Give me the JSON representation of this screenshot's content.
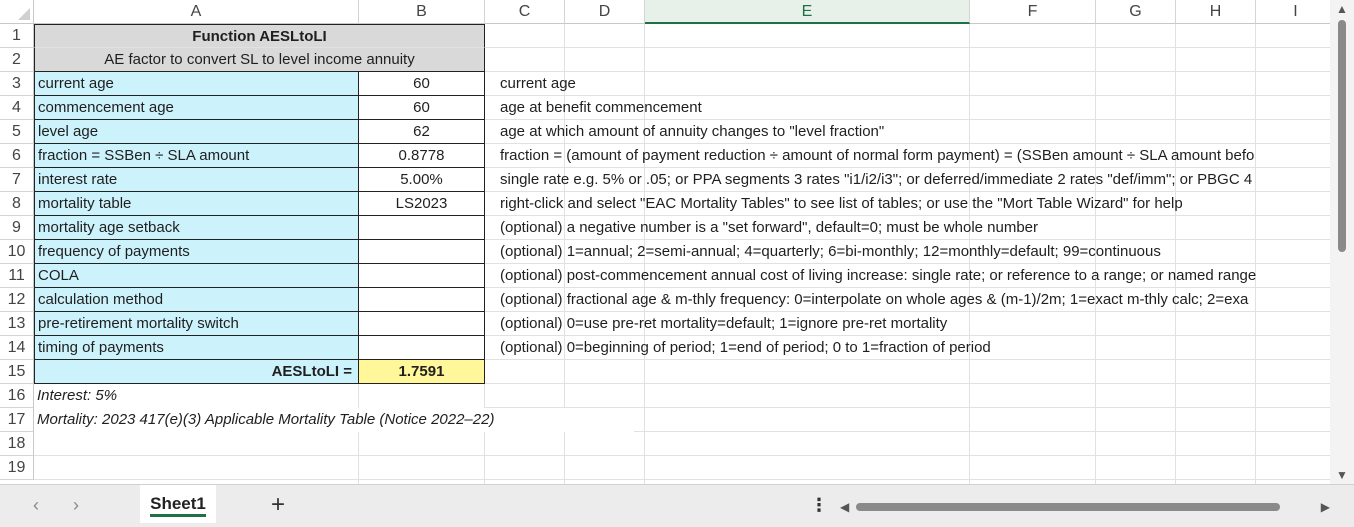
{
  "columns": [
    "A",
    "B",
    "C",
    "D",
    "E",
    "F",
    "G",
    "H",
    "I"
  ],
  "selected_column": "E",
  "rows": [
    "1",
    "2",
    "3",
    "4",
    "5",
    "6",
    "7",
    "8",
    "9",
    "10",
    "11",
    "12",
    "13",
    "14",
    "15",
    "16",
    "17",
    "18",
    "19"
  ],
  "header": {
    "title": "Function AESLtoLI",
    "subtitle": "AE factor to convert SL to level income annuity"
  },
  "params": [
    {
      "label": "current age",
      "value": "60",
      "desc": "current age"
    },
    {
      "label": "commencement age",
      "value": "60",
      "desc": "age at benefit commencement"
    },
    {
      "label": "level age",
      "value": "62",
      "desc": "age at which amount of annuity changes to \"level fraction\""
    },
    {
      "label": "fraction = SSBen ÷ SLA amount",
      "value": "0.8778",
      "desc": "fraction = (amount of payment reduction ÷ amount of normal form payment) = (SSBen amount ÷ SLA amount befo"
    },
    {
      "label": "interest rate",
      "value": "5.00%",
      "desc": "single rate e.g. 5% or .05; or PPA segments 3 rates \"i1/i2/i3\"; or deferred/immediate 2 rates \"def/imm\"; or PBGC 4"
    },
    {
      "label": "mortality table",
      "value": "LS2023",
      "desc": "right-click and select \"EAC Mortality Tables\" to see list of tables; or use the \"Mort Table Wizard\" for help"
    },
    {
      "label": "mortality age setback",
      "value": "",
      "desc": "(optional) a negative number is a \"set forward\", default=0; must be whole number"
    },
    {
      "label": "frequency of payments",
      "value": "",
      "desc": "(optional) 1=annual; 2=semi-annual; 4=quarterly; 6=bi-monthly; 12=monthly=default; 99=continuous"
    },
    {
      "label": "COLA",
      "value": "",
      "desc": "(optional) post-commencement annual cost of living increase: single rate; or reference to a range; or named range"
    },
    {
      "label": "calculation method",
      "value": "",
      "desc": "(optional) fractional age & m-thly frequency: 0=interpolate on whole ages & (m-1)/2m; 1=exact m-thly calc; 2=exa"
    },
    {
      "label": "pre-retirement mortality switch",
      "value": "",
      "desc": "(optional) 0=use pre-ret mortality=default; 1=ignore pre-ret mortality"
    },
    {
      "label": "timing of payments",
      "value": "",
      "desc": "(optional) 0=beginning of period; 1=end of period; 0 to 1=fraction of period"
    }
  ],
  "result": {
    "label": "AESLtoLI =",
    "value": "1.7591"
  },
  "notes": {
    "interest": "Interest: 5%",
    "mortality": "Mortality: 2023 417(e)(3) Applicable Mortality Table (Notice 2022–22)"
  },
  "sheetbar": {
    "tab_label": "Sheet1",
    "add_label": "+",
    "prev_label": "‹",
    "next_label": "›",
    "more_label": "⋮"
  },
  "colors": {
    "label_fill": "#ccf2fb",
    "header_fill": "#d9d9d9",
    "result_fill": "#fff799",
    "accent": "#1e7145"
  }
}
